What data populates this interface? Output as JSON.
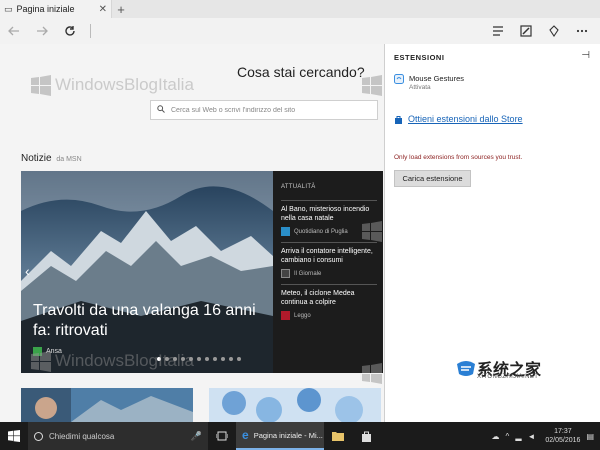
{
  "browser": {
    "tab_title": "Pagina iniziale",
    "tab_close": "✕",
    "new_tab": "+"
  },
  "nav": {
    "back_icon": "arrow-left-icon",
    "forward_icon": "arrow-right-icon",
    "refresh_icon": "refresh-icon"
  },
  "page": {
    "heading": "Cosa stai cercando?",
    "search_placeholder": "Cerca sul Web o scrivi l'indirizzo del sito",
    "news_label": "Notizie",
    "news_source": "da MSN",
    "hero": {
      "caption": "Travolti da una valanga 16 anni fa: ritrovati",
      "source": "Ansa",
      "dots_total": 11,
      "dots_active": 0
    },
    "side": {
      "heading": "ATTUALITÀ",
      "items": [
        {
          "title": "Al Bano, misterioso incendio nella casa natale",
          "source": "Quotidiano di Puglia",
          "color": "#2a8ec8"
        },
        {
          "title": "Arriva il contatore intelligente, cambiano i consumi",
          "source": "Il Giornale",
          "color": "#444444"
        },
        {
          "title": "Meteo, il ciclone Medea continua a colpire",
          "source": "Leggo",
          "color": "#b01a2b"
        }
      ]
    }
  },
  "extensions": {
    "heading": "ESTENSIONI",
    "item_name": "Mouse Gestures",
    "item_status": "Attivata",
    "store_link": "Ottieni estensioni dallo Store",
    "warning": "Only load extensions from sources you trust.",
    "load_button": "Carica estensione"
  },
  "watermark": {
    "text": "WindowsBlogItalia",
    "logo_cn": "系统之家",
    "logo_url": "XITONGZHIJIA.NET"
  },
  "taskbar": {
    "search_placeholder": "Chiedimi qualcosa",
    "app_label": "Pagina iniziale - Mi...",
    "time": "17:37",
    "date": "02/05/2016"
  },
  "colors": {
    "link": "#1764b8",
    "warning": "#8a1d1d",
    "taskbar": "#1b1b1b",
    "accent": "#3a8fe0"
  }
}
